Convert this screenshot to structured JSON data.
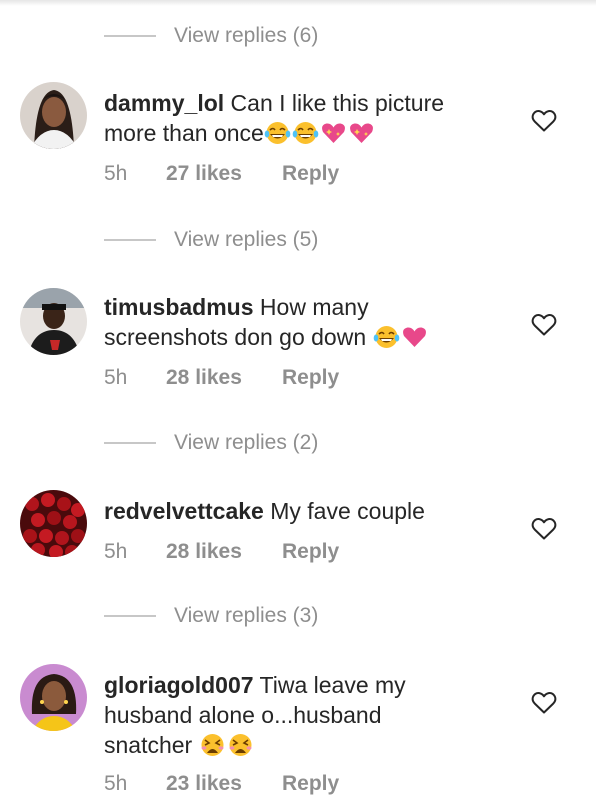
{
  "comments": [
    {
      "view_replies": "View replies (6)",
      "username": "dammy_lol",
      "text_line1": "Can I like this picture",
      "text_line2": "more than once",
      "emojis": [
        "grinning-tears-emoji",
        "grinning-tears-emoji",
        "sparkling-heart-emoji",
        "sparkling-heart-emoji"
      ],
      "time": "5h",
      "likes": "27 likes",
      "reply": "Reply"
    },
    {
      "view_replies": "View replies (5)",
      "username": "timusbadmus",
      "text_line1": "How many",
      "text_line2": "screenshots don go down",
      "emojis": [
        "grinning-tears-emoji",
        "pink-heart-emoji"
      ],
      "time": "5h",
      "likes": "28 likes",
      "reply": "Reply"
    },
    {
      "view_replies": "View replies (2)",
      "username": "redvelvettcake",
      "text_line1": "My fave couple",
      "time": "5h",
      "likes": "28 likes",
      "reply": "Reply"
    },
    {
      "view_replies": "View replies (3)",
      "username": "gloriagold007",
      "text_line1": "Tiwa leave my",
      "text_line2": "husband alone o...husband",
      "text_line3": "snatcher",
      "emojis": [
        "tired-face-emoji",
        "tired-face-emoji"
      ],
      "time": "5h",
      "likes": "23 likes",
      "reply": "Reply"
    }
  ],
  "colors": {
    "text": "#262626",
    "muted": "#8e8e8e",
    "divider": "#c7c7c7",
    "heart_emoji": "#e8488a",
    "emoji_yellow": "#fbc02d"
  },
  "icons": {
    "like_button": "heart-outline-icon"
  }
}
